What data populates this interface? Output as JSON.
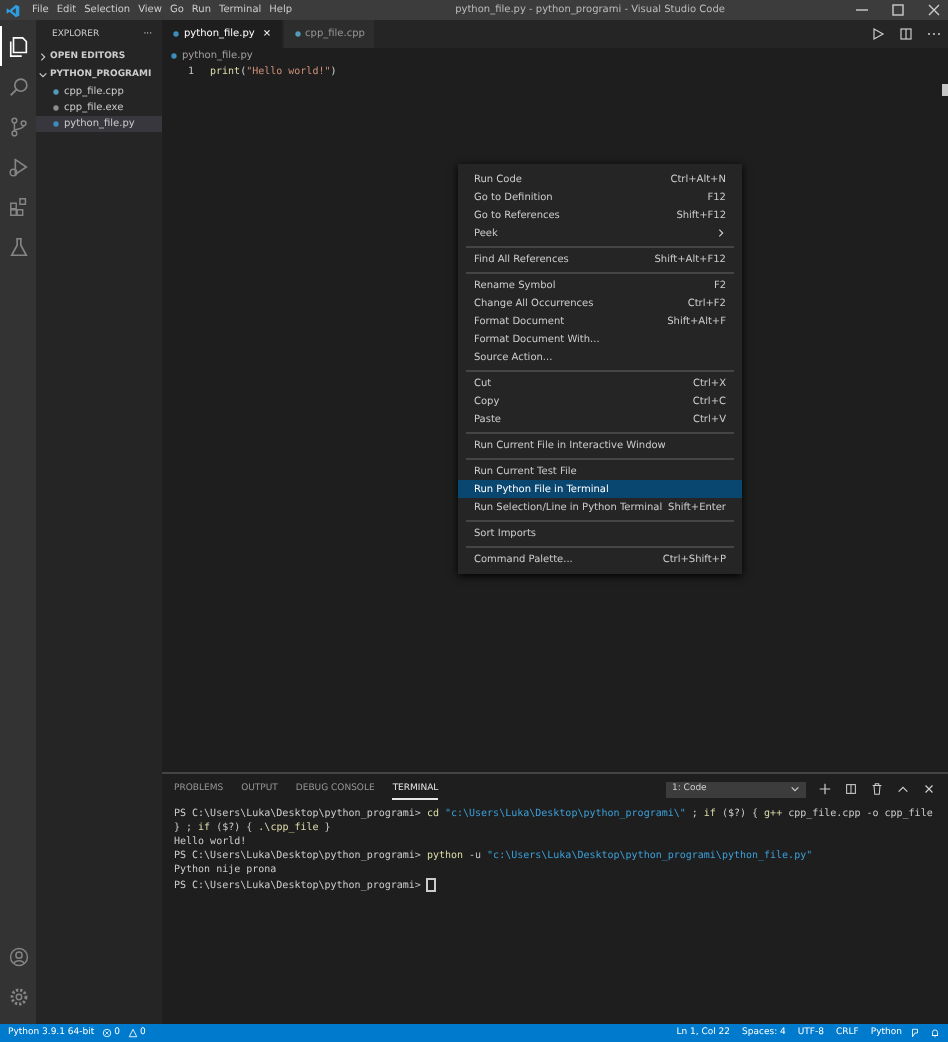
{
  "title_bar": {
    "menu": [
      "File",
      "Edit",
      "Selection",
      "View",
      "Go",
      "Run",
      "Terminal",
      "Help"
    ],
    "title": "python_file.py - python_programi - Visual Studio Code"
  },
  "activity_bar": {
    "items": [
      {
        "kind": "files",
        "selected": true
      },
      {
        "kind": "search",
        "selected": false
      },
      {
        "kind": "source-control",
        "selected": false
      },
      {
        "kind": "run",
        "selected": false
      },
      {
        "kind": "extensions",
        "selected": false
      },
      {
        "kind": "flask",
        "selected": false
      }
    ],
    "bottom": [
      {
        "kind": "account"
      },
      {
        "kind": "settings"
      }
    ]
  },
  "sidebar": {
    "title": "EXPLORER",
    "more": "···",
    "sections": [
      {
        "label": "OPEN EDITORS",
        "expanded": false
      },
      {
        "label": "PYTHON_PROGRAMI",
        "expanded": true,
        "files": [
          {
            "name": "cpp_file.cpp",
            "kind": "cpp",
            "selected": false
          },
          {
            "name": "cpp_file.exe",
            "kind": "exe",
            "selected": false
          },
          {
            "name": "python_file.py",
            "kind": "py",
            "selected": true
          }
        ]
      }
    ]
  },
  "tabs": [
    {
      "label": "python_file.py",
      "kind": "py",
      "selected": true,
      "close": "×"
    },
    {
      "label": "cpp_file.cpp",
      "kind": "cpp",
      "selected": false
    }
  ],
  "breadcrumb": "python_file.py",
  "code": [
    {
      "number": "1",
      "tokens": [
        {
          "kind": "fn",
          "text": "print"
        },
        {
          "kind": "punct",
          "text": "("
        },
        {
          "kind": "str",
          "text": "\"Hello world!\""
        },
        {
          "kind": "punct",
          "text": ")"
        }
      ]
    }
  ],
  "context_menu": {
    "groups": [
      [
        {
          "label": "Run Code",
          "shortcut": "Ctrl+Alt+N",
          "selected": false,
          "submenu": false
        },
        {
          "label": "Go to Definition",
          "shortcut": "F12",
          "selected": false,
          "submenu": false
        },
        {
          "label": "Go to References",
          "shortcut": "Shift+F12",
          "selected": false,
          "submenu": false
        },
        {
          "label": "Peek",
          "selected": false,
          "submenu": true
        }
      ],
      [
        {
          "label": "Find All References",
          "shortcut": "Shift+Alt+F12",
          "selected": false,
          "submenu": false
        }
      ],
      [
        {
          "label": "Rename Symbol",
          "shortcut": "F2",
          "selected": false,
          "submenu": false
        },
        {
          "label": "Change All Occurrences",
          "shortcut": "Ctrl+F2",
          "selected": false,
          "submenu": false
        },
        {
          "label": "Format Document",
          "shortcut": "Shift+Alt+F",
          "selected": false,
          "submenu": false
        },
        {
          "label": "Format Document With...",
          "selected": false,
          "submenu": false
        },
        {
          "label": "Source Action...",
          "selected": false,
          "submenu": false
        }
      ],
      [
        {
          "label": "Cut",
          "shortcut": "Ctrl+X",
          "selected": false,
          "submenu": false
        },
        {
          "label": "Copy",
          "shortcut": "Ctrl+C",
          "selected": false,
          "submenu": false
        },
        {
          "label": "Paste",
          "shortcut": "Ctrl+V",
          "selected": false,
          "submenu": false
        }
      ],
      [
        {
          "label": "Run Current File in Interactive Window",
          "selected": false,
          "submenu": false
        }
      ],
      [
        {
          "label": "Run Current Test File",
          "selected": false,
          "submenu": false
        },
        {
          "label": "Run Python File in Terminal",
          "selected": true,
          "submenu": false
        },
        {
          "label": "Run Selection/Line in Python Terminal",
          "shortcut": "Shift+Enter",
          "selected": false,
          "submenu": false
        }
      ],
      [
        {
          "label": "Sort Imports",
          "selected": false,
          "submenu": false
        }
      ],
      [
        {
          "label": "Command Palette...",
          "shortcut": "Ctrl+Shift+P",
          "selected": false,
          "submenu": false
        }
      ]
    ]
  },
  "panel": {
    "tabs": [
      {
        "label": "PROBLEMS",
        "selected": false
      },
      {
        "label": "OUTPUT",
        "selected": false
      },
      {
        "label": "DEBUG CONSOLE",
        "selected": false
      },
      {
        "label": "TERMINAL",
        "selected": true
      }
    ],
    "terminal_select": "1: Code",
    "lines": [
      [
        {
          "kind": "prompt",
          "text": "PS C:\\Users\\Luka\\Desktop\\python_programi> "
        },
        {
          "kind": "cmd",
          "text": "cd"
        },
        {
          "kind": "str",
          "text": " \"c:\\Users\\Luka\\Desktop\\python_programi\\\""
        },
        {
          "kind": "text",
          "text": " ; "
        },
        {
          "kind": "cmd",
          "text": "if"
        },
        {
          "kind": "text",
          "text": " ($?) { "
        },
        {
          "kind": "cmd",
          "text": "g++"
        },
        {
          "kind": "text",
          "text": " cpp_file.cpp -o cpp_file } ; "
        },
        {
          "kind": "cmd",
          "text": "if"
        },
        {
          "kind": "text",
          "text": " ($?) { "
        },
        {
          "kind": "cmd",
          "text": ".\\cpp_file"
        },
        {
          "kind": "text",
          "text": " }"
        }
      ],
      [
        {
          "kind": "text",
          "text": "Hello world!"
        }
      ],
      [
        {
          "kind": "prompt",
          "text": "PS C:\\Users\\Luka\\Desktop\\python_programi> "
        },
        {
          "kind": "cmd",
          "text": "python"
        },
        {
          "kind": "text",
          "text": " -u "
        },
        {
          "kind": "str",
          "text": "\"c:\\Users\\Luka\\Desktop\\python_programi\\python_file.py\""
        }
      ],
      [
        {
          "kind": "text",
          "text": "Python nije prona"
        }
      ],
      [
        {
          "kind": "prompt",
          "text": "PS C:\\Users\\Luka\\Desktop\\python_programi> "
        },
        {
          "kind": "cursor"
        }
      ]
    ]
  },
  "status_bar": {
    "interpreter": "Python 3.9.1 64-bit",
    "errors": "0",
    "warnings": "0",
    "right": [
      "Ln 1, Col 22",
      "Spaces: 4",
      "UTF-8",
      "CRLF",
      "Python"
    ]
  }
}
